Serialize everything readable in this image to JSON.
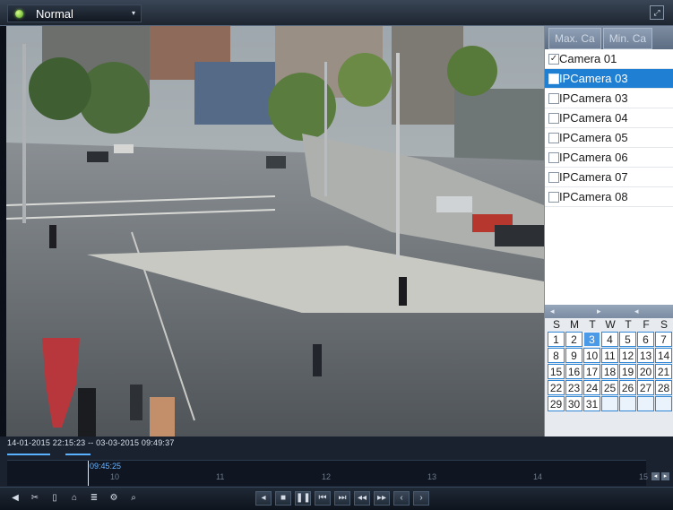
{
  "topbar": {
    "mode_label": "Normal",
    "mode_caret": "▾",
    "fullscreen_glyph": "⤢"
  },
  "tabs": [
    {
      "label": "Max. Ca"
    },
    {
      "label": "Min. Ca"
    }
  ],
  "cameras": [
    {
      "label": "Camera 01",
      "checked": true,
      "selected": false
    },
    {
      "label": "IPCamera 03",
      "checked": false,
      "selected": true
    },
    {
      "label": "IPCamera 03",
      "checked": false,
      "selected": false
    },
    {
      "label": "IPCamera 04",
      "checked": false,
      "selected": false
    },
    {
      "label": "IPCamera 05",
      "checked": false,
      "selected": false
    },
    {
      "label": "IPCamera 06",
      "checked": false,
      "selected": false
    },
    {
      "label": "IPCamera 07",
      "checked": false,
      "selected": false
    },
    {
      "label": "IPCamera 08",
      "checked": false,
      "selected": false
    }
  ],
  "calendar": {
    "weekdays": [
      "S",
      "M",
      "T",
      "W",
      "T",
      "F",
      "S"
    ],
    "days": [
      "1",
      "2",
      "3",
      "4",
      "5",
      "6",
      "7",
      "8",
      "9",
      "10",
      "11",
      "12",
      "13",
      "14",
      "15",
      "16",
      "17",
      "18",
      "19",
      "20",
      "21",
      "22",
      "23",
      "24",
      "25",
      "26",
      "27",
      "28",
      "29",
      "30",
      "31",
      "",
      "",
      "",
      ""
    ],
    "today": "3"
  },
  "timeline": {
    "range_text": "14-01-2015 22:15:23 -- 03-03-2015 09:49:37",
    "cursor_time": "09:45:25",
    "hour_labels": [
      "10",
      "11",
      "12",
      "13",
      "14",
      "15"
    ]
  },
  "colors": {
    "accent": "#1e7fd3",
    "record_segment": "#5ab2ff"
  }
}
